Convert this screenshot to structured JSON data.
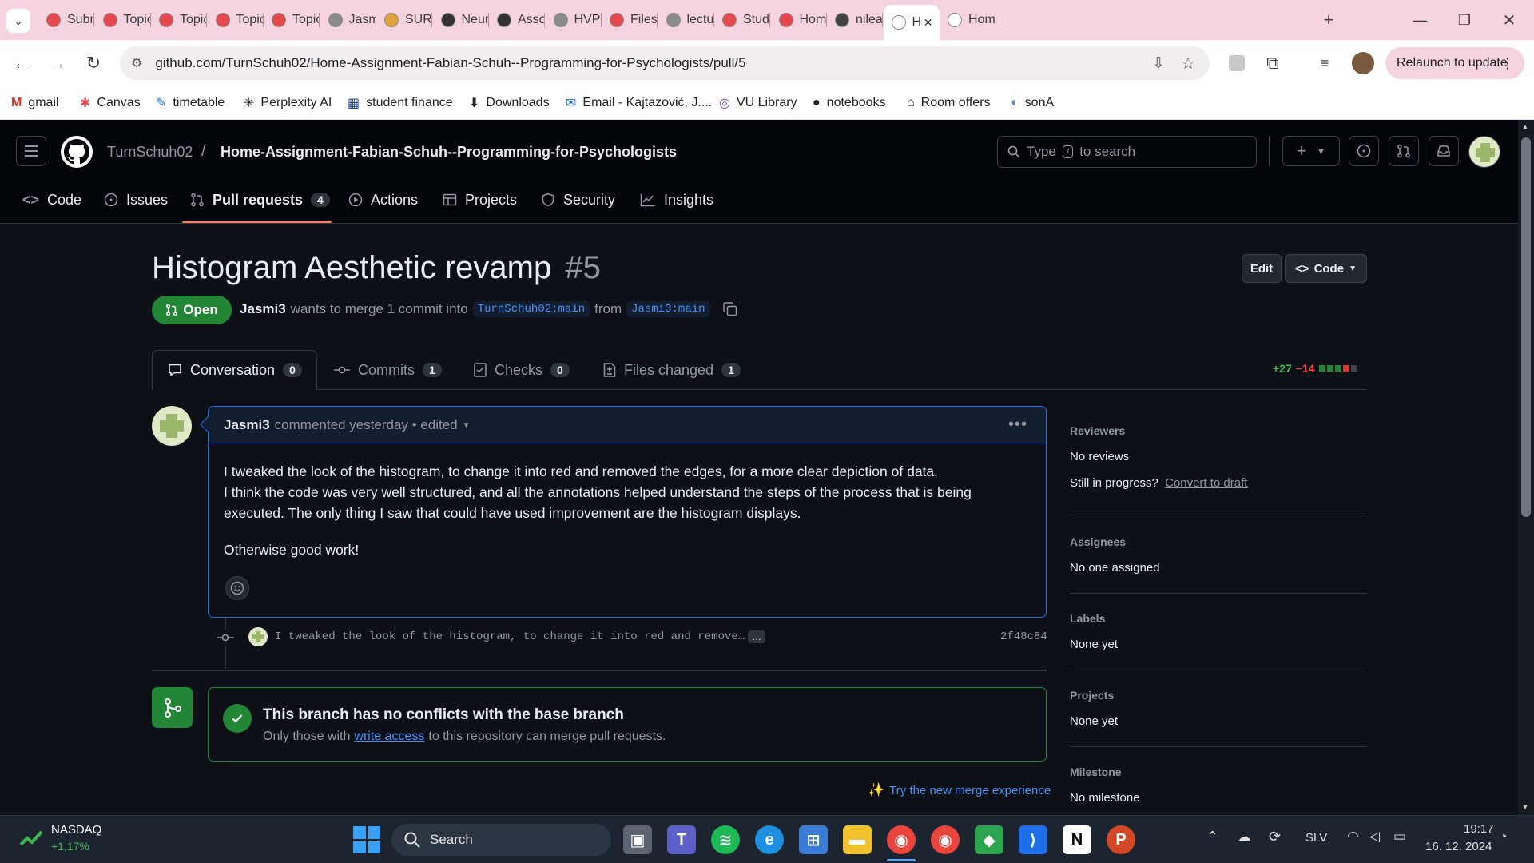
{
  "browser": {
    "tabs": [
      {
        "label": "Subm",
        "color": "#e5484d"
      },
      {
        "label": "Topic",
        "color": "#e5484d"
      },
      {
        "label": "Topic",
        "color": "#e5484d"
      },
      {
        "label": "Topic",
        "color": "#e5484d"
      },
      {
        "label": "Topic",
        "color": "#e5484d"
      },
      {
        "label": "Jasm",
        "color": "#8b8b8b"
      },
      {
        "label": "SURF",
        "color": "#e0a23a"
      },
      {
        "label": "Neur",
        "color": "#333333"
      },
      {
        "label": "Asso",
        "color": "#333333"
      },
      {
        "label": "HVP2",
        "color": "#8b8b8b"
      },
      {
        "label": "Files",
        "color": "#e5484d"
      },
      {
        "label": "lectu",
        "color": "#8b8b8b"
      },
      {
        "label": "Study",
        "color": "#e5484d"
      },
      {
        "label": "Hom",
        "color": "#e5484d"
      },
      {
        "label": "nilea",
        "color": "#444444"
      },
      {
        "label": "H",
        "color": "#ffffff"
      },
      {
        "label": "Hom",
        "color": "#ffffff"
      }
    ],
    "url": "github.com/TurnSchuh02/Home-Assignment-Fabian-Schuh--Programming-for-Psychologists/pull/5",
    "relaunch_label": "Relaunch to update",
    "bookmarks": [
      "gmail",
      "Canvas",
      "timetable",
      "Perplexity AI",
      "student finance",
      "Downloads",
      "Email - Kajtazović, J....",
      "VU Library",
      "notebooks",
      "Room offers",
      "sonA"
    ]
  },
  "github": {
    "owner": "TurnSchuh02",
    "repo": "Home-Assignment-Fabian-Schuh--Programming-for-Psychologists",
    "search_placeholder_pre": "Type",
    "search_key": "/",
    "search_placeholder_post": "to search",
    "nav": {
      "code": "Code",
      "issues": "Issues",
      "pulls": "Pull requests",
      "pulls_count": "4",
      "actions": "Actions",
      "projects": "Projects",
      "security": "Security",
      "insights": "Insights"
    },
    "pr": {
      "title": "Histogram Aesthetic revamp",
      "number": "#5",
      "edit_label": "Edit",
      "code_label": "Code",
      "state": "Open",
      "author": "Jasmi3",
      "merge_text": "wants to merge 1 commit into",
      "base_branch": "TurnSchuh02:main",
      "from_text": "from",
      "head_branch": "Jasmi3:main",
      "additions": "+27",
      "deletions": "−14"
    },
    "tabs": {
      "conversation": "Conversation",
      "conversation_count": "0",
      "commits": "Commits",
      "commits_count": "1",
      "checks": "Checks",
      "checks_count": "0",
      "files": "Files changed",
      "files_count": "1"
    },
    "comment": {
      "author": "Jasmi3",
      "meta": "commented yesterday • edited",
      "line1": "I tweaked the look of the histogram, to change it into red and removed the edges, for a more clear depiction of data.",
      "line2": "I think the code was very well structured, and all the annotations helped understand the steps of the process that is being executed. The only thing I saw that could have used improvement are the histogram displays.",
      "line3": "Otherwise good work!"
    },
    "commit": {
      "message": "I tweaked the look of the histogram, to change it into red and remove…",
      "ellipsis": "…",
      "sha": "2f48c84"
    },
    "merge": {
      "title": "This branch has no conflicts with the base branch",
      "sub_pre": "Only those with",
      "sub_link": "write access",
      "sub_post": "to this repository can merge pull requests.",
      "try_new": "Try the new merge experience"
    },
    "sidebar": {
      "reviewers_h": "Reviewers",
      "reviewers_v": "No reviews",
      "in_progress": "Still in progress?",
      "convert": "Convert to draft",
      "assignees_h": "Assignees",
      "assignees_v": "No one assigned",
      "labels_h": "Labels",
      "labels_v": "None yet",
      "projects_h": "Projects",
      "projects_v": "None yet",
      "milestone_h": "Milestone",
      "milestone_v": "No milestone"
    }
  },
  "taskbar": {
    "ticker_name": "NASDAQ",
    "ticker_change": "+1,17%",
    "search": "Search",
    "lang": "SLV",
    "time": "19:17",
    "date": "16. 12. 2024"
  }
}
